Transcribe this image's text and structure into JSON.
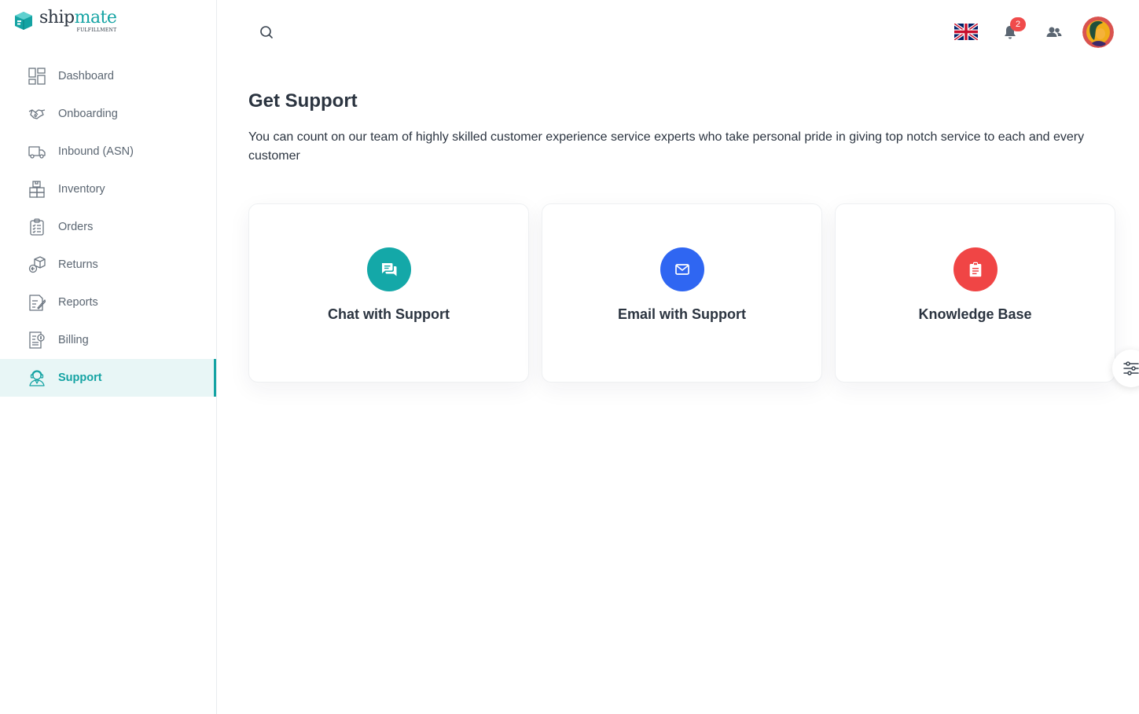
{
  "app": {
    "logo_main": "ship",
    "logo_accent": "mate",
    "logo_sub": "FULFILLMENT"
  },
  "sidebar": {
    "items": [
      {
        "label": "Dashboard",
        "icon": "dashboard-icon",
        "active": false
      },
      {
        "label": "Onboarding",
        "icon": "handshake-icon",
        "active": false
      },
      {
        "label": "Inbound (ASN)",
        "icon": "truck-icon",
        "active": false
      },
      {
        "label": "Inventory",
        "icon": "boxes-icon",
        "active": false
      },
      {
        "label": "Orders",
        "icon": "clipboard-icon",
        "active": false
      },
      {
        "label": "Returns",
        "icon": "return-box-icon",
        "active": false
      },
      {
        "label": "Reports",
        "icon": "report-icon",
        "active": false
      },
      {
        "label": "Billing",
        "icon": "invoice-icon",
        "active": false
      },
      {
        "label": "Support",
        "icon": "support-agent-icon",
        "active": true
      }
    ]
  },
  "topbar": {
    "notification_count": "2",
    "language_icon": "uk-flag-icon"
  },
  "main": {
    "title": "Get Support",
    "description": "You can count on our team of highly skilled customer experience service experts who take personal pride in giving top notch service to each and every customer",
    "cards": [
      {
        "label": "Chat with Support",
        "icon": "chat-icon",
        "color": "#14a8a8"
      },
      {
        "label": "Email with Support",
        "icon": "mail-icon",
        "color": "#2f66f2"
      },
      {
        "label": "Knowledge Base",
        "icon": "clipboard-text-icon",
        "color": "#f04545"
      }
    ]
  },
  "colors": {
    "accent": "#14a3a3",
    "badge": "#f04b4b"
  }
}
